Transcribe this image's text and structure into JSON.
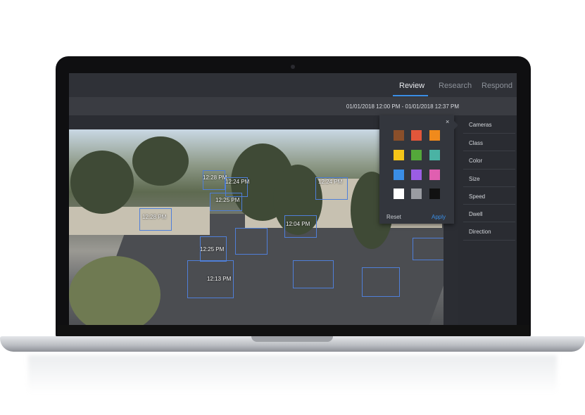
{
  "header": {
    "tabs": [
      {
        "label": "Review",
        "active": true
      },
      {
        "label": "Research",
        "active": false
      },
      {
        "label": "Respond",
        "active": false
      }
    ],
    "accent_color": "#3a8ee6"
  },
  "datebar": {
    "range": "01/01/2018 12:00 PM - 01/01/2018 12:37 PM"
  },
  "video": {
    "timestamps": [
      "12:28 PM",
      "12:24 PM",
      "12:25 PM",
      "12:28 PM",
      "12:24 PM",
      "12:25 PM",
      "12:04 PM",
      "12:13 PM"
    ]
  },
  "filters": {
    "items": [
      "Cameras",
      "Class",
      "Color",
      "Size",
      "Speed",
      "Dwell",
      "Direction"
    ]
  },
  "color_popover": {
    "close_icon": "close-icon",
    "close_glyph": "×",
    "swatches": [
      "#8a4f2a",
      "#e2563a",
      "#f08a1c",
      "#f5c518",
      "#54a83a",
      "#4ab3a4",
      "#3a8ee6",
      "#9b5de5",
      "#e05fb0",
      "#ffffff",
      "#9a9ca2",
      "#111111"
    ],
    "reset_label": "Reset",
    "apply_label": "Apply"
  }
}
